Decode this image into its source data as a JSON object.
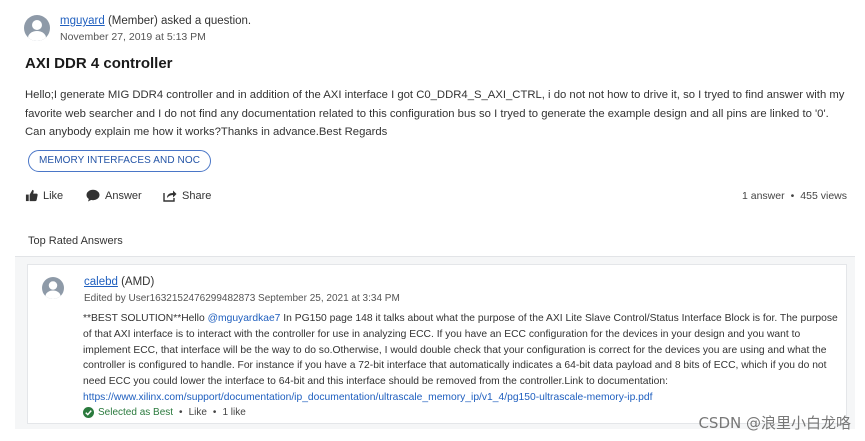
{
  "question": {
    "author": "mguyard",
    "role_text": "(Member) asked a question.",
    "date": "November 27, 2019 at 5:13 PM",
    "title": "AXI DDR 4 controller",
    "body": "Hello;I generate MIG DDR4 controller and in addition of the AXI interface I got C0_DDR4_S_AXI_CTRL, i do not not how to drive it, so I tryed to find answer with my favorite web searcher and I do not find any documentation related to this configuration bus so I tryed to generate the example design and all pins are linked to '0'. Can anybody explain me how it works?Thanks in advance.Best Regards",
    "tag": "MEMORY INTERFACES AND NOC"
  },
  "actions": {
    "like_label": "Like",
    "answer_label": "Answer",
    "share_label": "Share"
  },
  "stats": {
    "answers": "1 answer",
    "separator": "•",
    "views": "455 views"
  },
  "section_title": "Top Rated Answers",
  "answer": {
    "author": "calebd",
    "role_text": "(AMD)",
    "edited": "Edited by User1632152476299482873 September 25, 2021 at 3:34 PM",
    "body_part1": "**BEST SOLUTION**Hello ",
    "mention": "@mguyardkae7",
    "body_part2": " In PG150 page 148 it talks about what the purpose of the AXI Lite Slave Control/Status Interface Block is for.  The purpose of that AXI interface is to interact with the controller for use in analyzing ECC.  If you have an ECC configuration for the devices in your design and you want to implement ECC, that interface will be the way to do so.Otherwise, I would double check that your configuration is correct for the devices you are using and what the controller is configured to handle.  For instance if you have a 72-bit interface that automatically indicates a 64-bit data payload and 8 bits of ECC, which if you do not need ECC you could lower the interface to 64-bit and this interface should be removed from the controller.Link to documentation:",
    "doc_link": "https://www.xilinx.com/support/documentation/ip_documentation/ultrascale_memory_ip/v1_4/pg150-ultrascale-memory-ip.pdf",
    "best_label": "Selected as Best",
    "like_label": "Like",
    "likes": "1 like",
    "dot": "•"
  },
  "watermark": "CSDN @浪里小白龙咯",
  "colors": {
    "link": "#1f5fbf",
    "tag_border": "#4a76c7",
    "best_green": "#2a7a3d",
    "avatar": "#8e9aa8"
  }
}
